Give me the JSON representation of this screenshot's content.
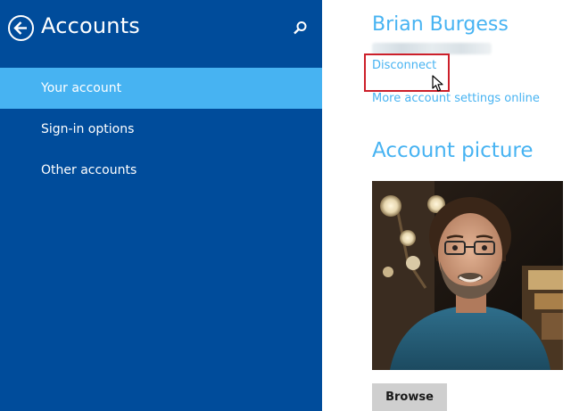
{
  "left_pane": {
    "title": "Accounts",
    "nav_items": [
      {
        "label": "Your account",
        "selected": true
      },
      {
        "label": "Sign-in options",
        "selected": false
      },
      {
        "label": "Other accounts",
        "selected": false
      }
    ]
  },
  "right_pane": {
    "user_name": "Brian Burgess",
    "links": {
      "disconnect": "Disconnect",
      "more_settings": "More account settings online"
    },
    "section_heading": "Account picture",
    "browse_label": "Browse"
  },
  "colors": {
    "left_background": "#004c9b",
    "selected_item": "#47b3f2",
    "accent": "#47b3f2",
    "highlight_box": "#cc1f2a",
    "button_background": "#cfcfcf"
  },
  "icons": {
    "back": "back-arrow-icon",
    "search": "search-icon",
    "cursor": "mouse-cursor-icon"
  }
}
